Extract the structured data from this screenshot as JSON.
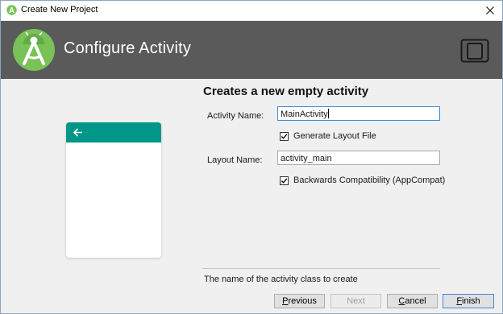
{
  "window": {
    "title": "Create New Project"
  },
  "header": {
    "title": "Configure Activity"
  },
  "form": {
    "section_title": "Creates a new empty activity",
    "activity_name_label": "Activity Name:",
    "activity_name_value": "MainActivity",
    "generate_layout_label": "Generate Layout File",
    "generate_layout_checked": true,
    "layout_name_label": "Layout Name:",
    "layout_name_value": "activity_main",
    "backwards_compat_label": "Backwards Compatibility (AppCompat)",
    "backwards_compat_checked": true,
    "help_text": "The name of the activity class to create"
  },
  "buttons": {
    "previous_first": "P",
    "previous_rest": "revious",
    "next": "Next",
    "cancel_first": "C",
    "cancel_rest": "ancel",
    "finish_first": "F",
    "finish_rest": "inish"
  },
  "colors": {
    "header_bg": "#5a5a5a",
    "android_green": "#78c257",
    "preview_appbar": "#009688",
    "focus_border": "#3b8ad9"
  }
}
